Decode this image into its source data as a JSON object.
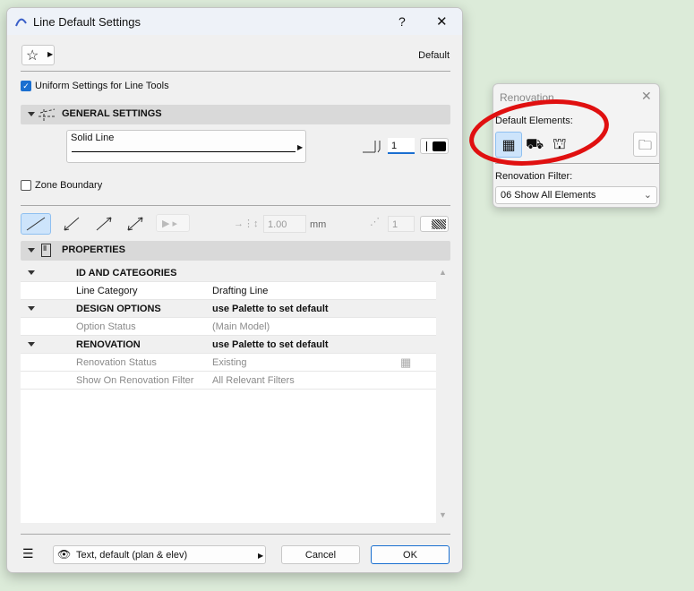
{
  "dialog": {
    "title": "Line Default Settings",
    "help": "?",
    "close": "✕",
    "preset_label": "Default",
    "uniform_label": "Uniform Settings for Line Tools",
    "uniform_checked": true,
    "general_header": "GENERAL SETTINGS",
    "line_type": "Solid Line",
    "pen_value": "1",
    "zone_label": "Zone Boundary",
    "zone_checked": false,
    "arrow_size": "1.00",
    "arrow_unit": "mm",
    "arrow_pen": "1",
    "properties_header": "PROPERTIES",
    "rows": [
      {
        "label": "ID AND CATEGORIES",
        "value": ""
      },
      {
        "label": "Line Category",
        "value": "Drafting Line"
      },
      {
        "label": "DESIGN OPTIONS",
        "value": "use Palette to set default"
      },
      {
        "label": "Option Status",
        "value": "(Main Model)"
      },
      {
        "label": "RENOVATION",
        "value": "use Palette to set default"
      },
      {
        "label": "Renovation Status",
        "value": "Existing"
      },
      {
        "label": "Show On Renovation Filter",
        "value": "All Relevant Filters"
      }
    ],
    "layer": "Text, default (plan & elev)",
    "cancel": "Cancel",
    "ok": "OK"
  },
  "palette": {
    "title": "Renovation",
    "default_label": "Default Elements:",
    "filter_label": "Renovation Filter:",
    "filter_value": "06 Show All Elements"
  },
  "colors": {
    "accent": "#1a6fd0",
    "highlight": "#e01010"
  }
}
